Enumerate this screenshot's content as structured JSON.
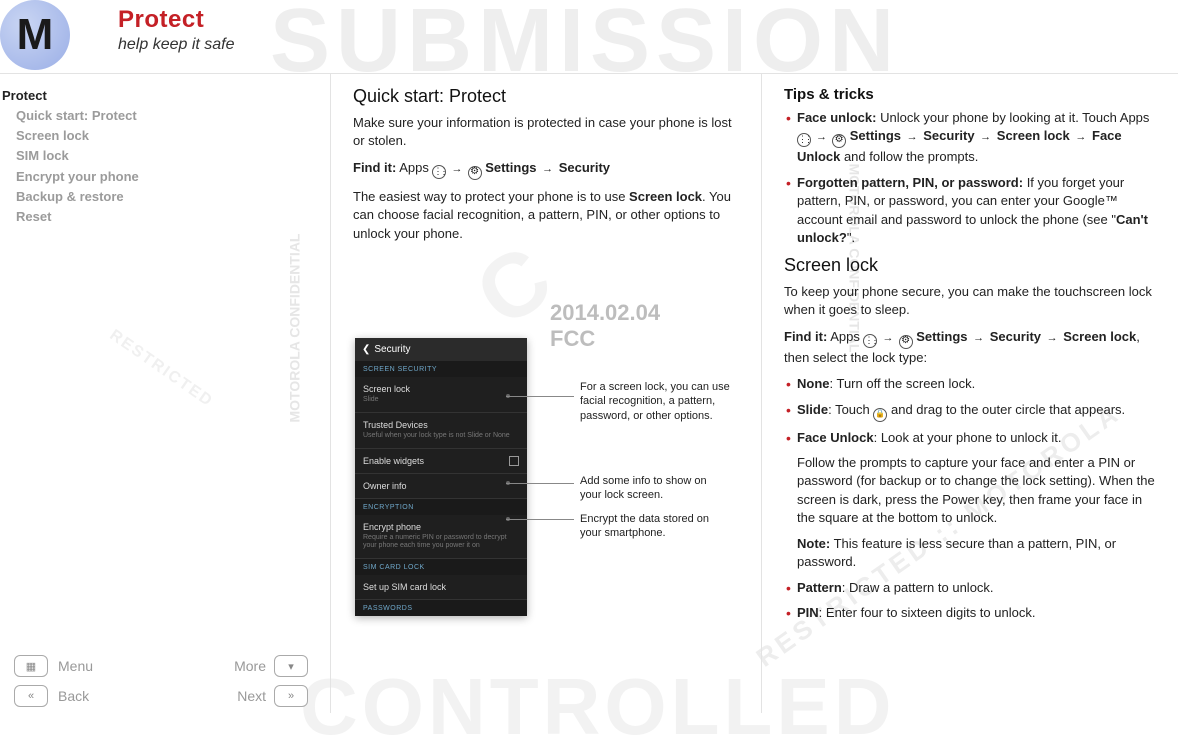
{
  "header": {
    "title": "Protect",
    "subtitle": "help keep it safe"
  },
  "watermark": {
    "submission": "SUBMISSION",
    "date": "2014.02.04",
    "fcc": "FCC",
    "side1": "MOTOROLA CONFIDENTIAL",
    "side2": "MOTOROLA CONFIDENTIAL",
    "big_c": "C",
    "restricted": "RESTRICTED :: MOTOROLA",
    "restricted2": "RESTRICTED",
    "controlled": "CONTROLLED"
  },
  "sidebar": {
    "items": [
      {
        "label": "Protect",
        "active": true,
        "indent": false
      },
      {
        "label": "Quick start: Protect",
        "active": false,
        "indent": true
      },
      {
        "label": "Screen lock",
        "active": false,
        "indent": true
      },
      {
        "label": "SIM lock",
        "active": false,
        "indent": true
      },
      {
        "label": "Encrypt your phone",
        "active": false,
        "indent": true
      },
      {
        "label": "Backup & restore",
        "active": false,
        "indent": true
      },
      {
        "label": "Reset",
        "active": false,
        "indent": true
      }
    ]
  },
  "col1": {
    "h2": "Quick start: Protect",
    "p1": "Make sure your information is protected in case your phone is lost or stolen.",
    "findit_label": "Find it:",
    "findit_apps": " Apps ",
    "findit_settings": " Settings ",
    "findit_security": " Security",
    "p2a": "The easiest way to protect your phone is to use ",
    "p2b": "Screen lock",
    "p2c": ". You can choose facial recognition, a pattern, PIN, or other options to unlock your phone."
  },
  "phone": {
    "title": "Security",
    "sec1": "SCREEN SECURITY",
    "row1": "Screen lock",
    "row1sub": "Slide",
    "row2": "Trusted Devices",
    "row2sub": "Useful when your lock type is not Slide or None",
    "row3": "Enable widgets",
    "row4": "Owner info",
    "sec2": "ENCRYPTION",
    "row5": "Encrypt phone",
    "row5sub": "Require a numeric PIN or password to decrypt your phone each time you power it on",
    "sec3": "SIM CARD LOCK",
    "row6": "Set up SIM card lock",
    "sec4": "PASSWORDS"
  },
  "callouts": {
    "c1": "For a screen lock, you can use facial recognition, a pattern, password, or other options.",
    "c2": "Add some info to show on your lock screen.",
    "c3": "Encrypt the data stored on your smartphone."
  },
  "col2": {
    "tips_h": "Tips & tricks",
    "tip1a": "Face unlock:",
    "tip1b": " Unlock your phone by looking at it. Touch Apps ",
    "tip1c": " Settings ",
    "tip1d": " Security ",
    "tip1e": " Screen lock ",
    "tip1f": " Face Unlock",
    "tip1g": " and follow the prompts.",
    "tip2a": "Forgotten pattern, PIN, or password:",
    "tip2b": " If you forget your pattern, PIN, or password, you can enter your Google™ account email and password to unlock the phone (see \"",
    "tip2c": "Can't unlock?",
    "tip2d": "\".",
    "sl_h": "Screen lock",
    "sl_p1": "To keep your phone secure, you can make the touchscreen lock when it goes to sleep.",
    "sl_findit_label": "Find it:",
    "sl_findit_a": " Apps ",
    "sl_findit_b": " Settings ",
    "sl_findit_c": " Security ",
    "sl_findit_d": " Screen lock",
    "sl_findit_e": ", then select the lock type:",
    "b_none_a": "None",
    "b_none_b": ": Turn off the screen lock.",
    "b_slide_a": "Slide",
    "b_slide_b": ": Touch ",
    "b_slide_c": " and drag to the outer circle that appears.",
    "b_face_a": "Face Unlock",
    "b_face_b": ": Look at your phone to unlock it.",
    "b_face_p1": "Follow the prompts to capture your face and enter a PIN or password (for backup or to change the lock setting). When the screen is dark, press the Power key, then frame your face in the square at the bottom to unlock.",
    "b_face_note_a": "Note:",
    "b_face_note_b": " This feature is less secure than a pattern, PIN, or password.",
    "b_pat_a": "Pattern",
    "b_pat_b": ": Draw a pattern to unlock.",
    "b_pin_a": "PIN",
    "b_pin_b": ": Enter four to sixteen digits to unlock."
  },
  "nav": {
    "menu": "Menu",
    "more": "More",
    "back": "Back",
    "next": "Next"
  }
}
